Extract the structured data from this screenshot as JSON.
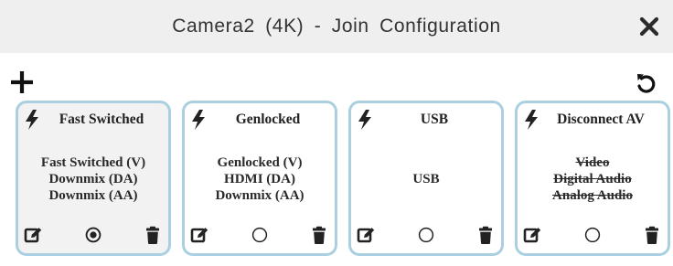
{
  "window": {
    "title": "Camera2 (4K) - Join Configuration"
  },
  "icons": {
    "close": "close-x-icon",
    "add": "plus-icon",
    "reset": "undo-icon",
    "card_type": "lightning-bolt-icon",
    "edit": "edit-icon",
    "select": "radio-icon",
    "delete": "trash-icon"
  },
  "colors": {
    "card_border": "#a9cfe0",
    "active_card_bg": "#f2f2f2",
    "icon": "#222222"
  },
  "cards": [
    {
      "title": "Fast Switched",
      "selected": true,
      "lines": [
        {
          "text": "Fast Switched (V)",
          "struck": false
        },
        {
          "text": "Downmix (DA)",
          "struck": false
        },
        {
          "text": "Downmix (AA)",
          "struck": false
        }
      ]
    },
    {
      "title": "Genlocked",
      "selected": false,
      "lines": [
        {
          "text": "Genlocked (V)",
          "struck": false
        },
        {
          "text": "HDMI (DA)",
          "struck": false
        },
        {
          "text": "Downmix (AA)",
          "struck": false
        }
      ]
    },
    {
      "title": "USB",
      "selected": false,
      "lines": [
        {
          "text": "USB",
          "struck": false
        }
      ]
    },
    {
      "title": "Disconnect AV",
      "selected": false,
      "lines": [
        {
          "text": "Video",
          "struck": true
        },
        {
          "text": "Digital Audio",
          "struck": true
        },
        {
          "text": "Analog Audio",
          "struck": true
        }
      ]
    }
  ]
}
